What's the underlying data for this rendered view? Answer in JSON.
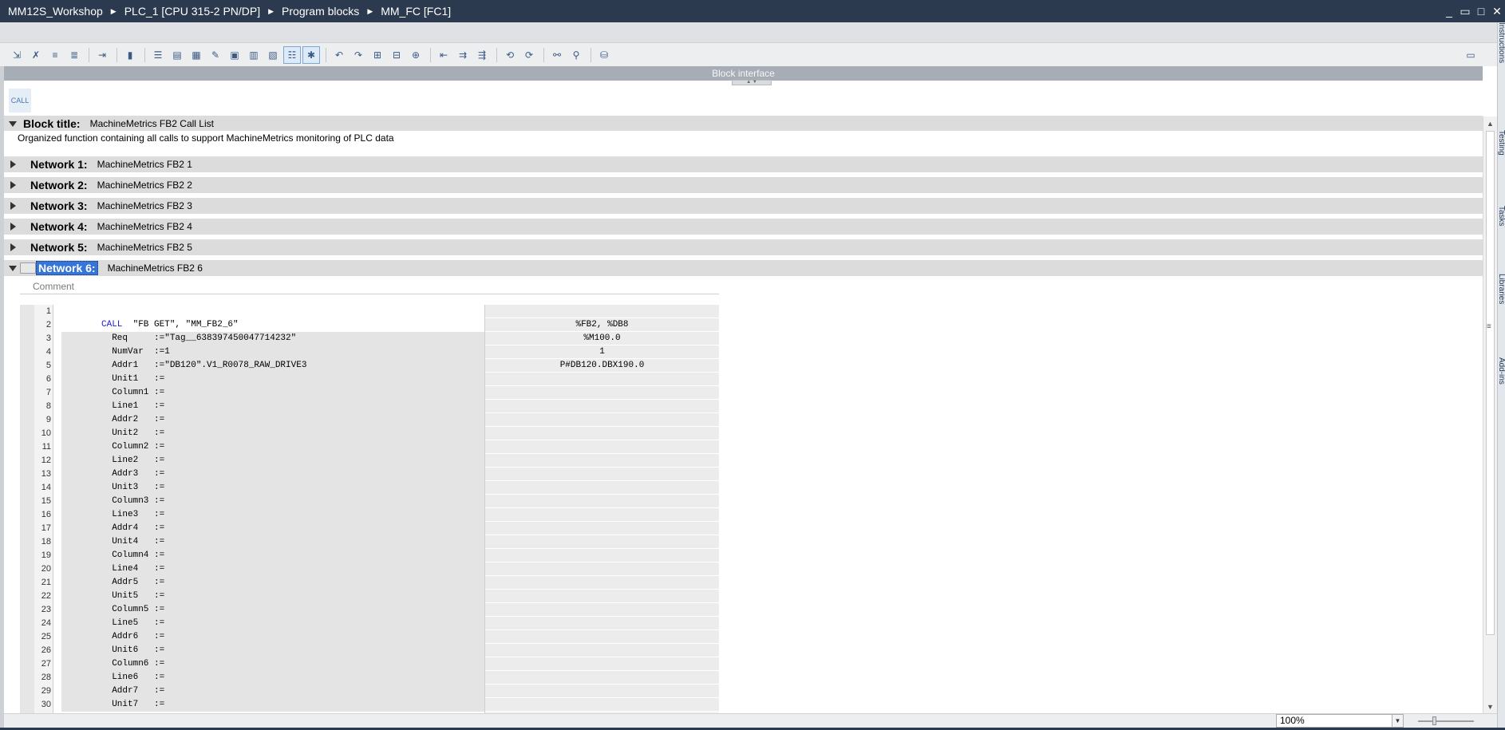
{
  "breadcrumb": [
    "MM12S_Workshop",
    "PLC_1 [CPU 315-2 PN/DP]",
    "Program blocks",
    "MM_FC [FC1]"
  ],
  "window_controls": {
    "minimize": "_",
    "restore": "▭",
    "maximize": "□",
    "close": "✕"
  },
  "toolbar_icons": [
    "insert-network-icon",
    "delete-network-icon",
    "insert-row-icon",
    "add-row-icon",
    "comment-in-icon",
    "comment-out-icon",
    "indent-icon",
    "outdent-icon",
    "auto-indent-icon",
    "comment-icon",
    "favorites-icon",
    "display-comments-icon",
    "bookmark-icon",
    "next-bookmark-icon",
    "prev-bookmark-icon",
    "delete-bookmark-icon",
    "monitor-icon",
    "absolute-operands-icon",
    "go-to-line-icon",
    "call-structure-icon",
    "tag-info-icon",
    "breakpoint-icon",
    "step-icon",
    "watch-icon",
    "compare-icon"
  ],
  "interface_bar": "Block interface",
  "favorites": {
    "call_label": "CALL"
  },
  "block": {
    "title_label": "Block title:",
    "title": "MachineMetrics FB2 Call List",
    "comment": "Organized function containing all calls to support MachineMetrics monitoring of PLC data"
  },
  "networks": [
    {
      "label": "Network 1:",
      "title": "MachineMetrics FB2 1"
    },
    {
      "label": "Network 2:",
      "title": "MachineMetrics FB2 2"
    },
    {
      "label": "Network 3:",
      "title": "MachineMetrics FB2 3"
    },
    {
      "label": "Network 4:",
      "title": "MachineMetrics FB2 4"
    },
    {
      "label": "Network 5:",
      "title": "MachineMetrics FB2 5"
    },
    {
      "label": "Network 6:",
      "title": "MachineMetrics FB2 6"
    }
  ],
  "network6": {
    "comment_placeholder": "Comment",
    "code_lines": [
      {
        "n": "1",
        "kw": "",
        "code": "",
        "addr": ""
      },
      {
        "n": "2",
        "kw": "CALL",
        "code": "  \"FB GET\", \"MM_FB2_6\"",
        "addr": "%FB2, %DB8"
      },
      {
        "n": "3",
        "kw": "",
        "code": "  Req     :=\"Tag__638397450047714232\"",
        "addr": "%M100.0"
      },
      {
        "n": "4",
        "kw": "",
        "code": "  NumVar  :=1",
        "addr": "1"
      },
      {
        "n": "5",
        "kw": "",
        "code": "  Addr1   :=\"DB120\".V1_R0078_RAW_DRIVE3",
        "addr": "P#DB120.DBX190.0"
      },
      {
        "n": "6",
        "kw": "",
        "code": "  Unit1   :=",
        "addr": ""
      },
      {
        "n": "7",
        "kw": "",
        "code": "  Column1 :=",
        "addr": ""
      },
      {
        "n": "8",
        "kw": "",
        "code": "  Line1   :=",
        "addr": ""
      },
      {
        "n": "9",
        "kw": "",
        "code": "  Addr2   :=",
        "addr": ""
      },
      {
        "n": "10",
        "kw": "",
        "code": "  Unit2   :=",
        "addr": ""
      },
      {
        "n": "11",
        "kw": "",
        "code": "  Column2 :=",
        "addr": ""
      },
      {
        "n": "12",
        "kw": "",
        "code": "  Line2   :=",
        "addr": ""
      },
      {
        "n": "13",
        "kw": "",
        "code": "  Addr3   :=",
        "addr": ""
      },
      {
        "n": "14",
        "kw": "",
        "code": "  Unit3   :=",
        "addr": ""
      },
      {
        "n": "15",
        "kw": "",
        "code": "  Column3 :=",
        "addr": ""
      },
      {
        "n": "16",
        "kw": "",
        "code": "  Line3   :=",
        "addr": ""
      },
      {
        "n": "17",
        "kw": "",
        "code": "  Addr4   :=",
        "addr": ""
      },
      {
        "n": "18",
        "kw": "",
        "code": "  Unit4   :=",
        "addr": ""
      },
      {
        "n": "19",
        "kw": "",
        "code": "  Column4 :=",
        "addr": ""
      },
      {
        "n": "20",
        "kw": "",
        "code": "  Line4   :=",
        "addr": ""
      },
      {
        "n": "21",
        "kw": "",
        "code": "  Addr5   :=",
        "addr": ""
      },
      {
        "n": "22",
        "kw": "",
        "code": "  Unit5   :=",
        "addr": ""
      },
      {
        "n": "23",
        "kw": "",
        "code": "  Column5 :=",
        "addr": ""
      },
      {
        "n": "24",
        "kw": "",
        "code": "  Line5   :=",
        "addr": ""
      },
      {
        "n": "25",
        "kw": "",
        "code": "  Addr6   :=",
        "addr": ""
      },
      {
        "n": "26",
        "kw": "",
        "code": "  Unit6   :=",
        "addr": ""
      },
      {
        "n": "27",
        "kw": "",
        "code": "  Column6 :=",
        "addr": ""
      },
      {
        "n": "28",
        "kw": "",
        "code": "  Line6   :=",
        "addr": ""
      },
      {
        "n": "29",
        "kw": "",
        "code": "  Addr7   :=",
        "addr": ""
      },
      {
        "n": "30",
        "kw": "",
        "code": "  Unit7   :=",
        "addr": ""
      }
    ]
  },
  "statusbar": {
    "zoom": "100%"
  },
  "right_tabs": [
    "Instructions",
    "Testing",
    "Tasks",
    "Libraries",
    "Add-ins"
  ],
  "colors": {
    "titlebar": "#2c3a4f",
    "selection": "#3574d8",
    "keyword": "#1a1ae6"
  }
}
